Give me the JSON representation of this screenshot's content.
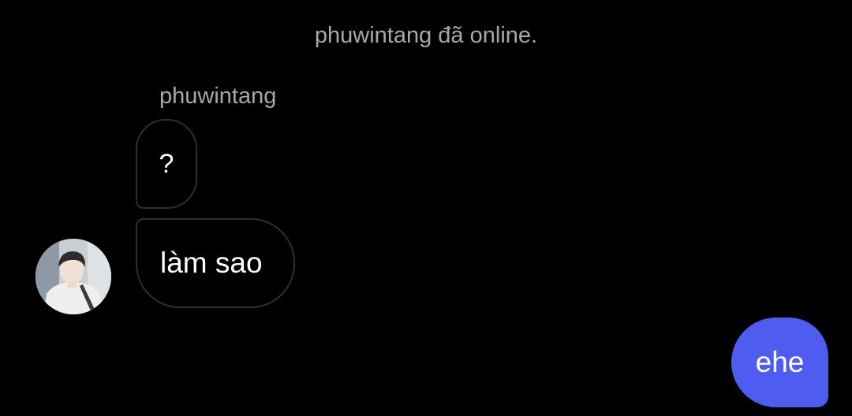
{
  "chat": {
    "status_text": "phuwintang đã online.",
    "sender_name": "phuwintang",
    "incoming_messages": [
      {
        "text": "?"
      },
      {
        "text": "làm sao"
      }
    ],
    "outgoing_messages": [
      {
        "text": "ehe"
      }
    ],
    "avatar_icon": "user-profile-photo"
  },
  "colors": {
    "background": "#000000",
    "outgoing_bubble": "#4f5cf0",
    "incoming_bubble_border": "#2f2f2f",
    "secondary_text": "#a8a8a8",
    "primary_text": "#ffffff"
  }
}
